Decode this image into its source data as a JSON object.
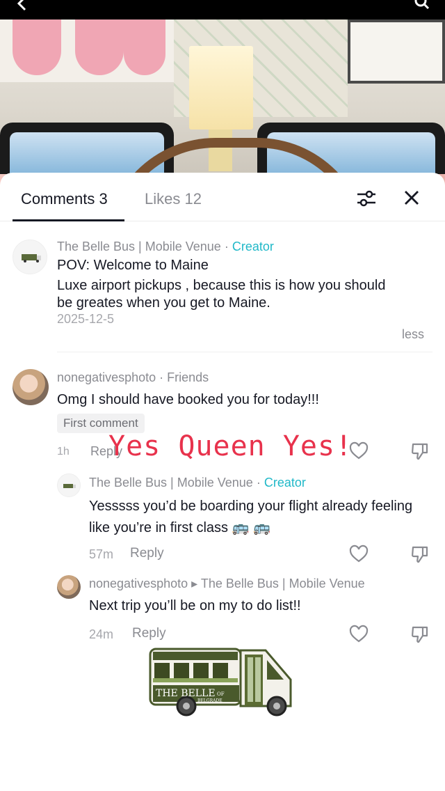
{
  "sheet": {
    "tabs": {
      "comments_label": "Comments 3",
      "likes_label": "Likes 12"
    }
  },
  "caption_comment": {
    "author": "The Belle Bus | Mobile Venue",
    "separator": " · ",
    "badge": "Creator",
    "title": "POV:  Welcome to Maine",
    "body": "Luxe airport pickups , because this is how you should be greates when you get to Maine.",
    "date": "2025-12-5",
    "less_label": "less"
  },
  "comments": [
    {
      "author": "nonegativesphoto",
      "separator": " · ",
      "relation": "Friends",
      "text": "Omg I should have booked you for today!!!",
      "chip": "First comment",
      "time": "1h",
      "reply_label": "Reply"
    }
  ],
  "replies": [
    {
      "author": "The Belle Bus | Mobile Venue",
      "separator": " · ",
      "badge": "Creator",
      "text": "Yesssss you’d be boarding your flight already feeling like you’re in first class 🚌 🚌",
      "time": "57m",
      "reply_label": "Reply"
    },
    {
      "author": "nonegativesphoto",
      "arrow": " ▸ ",
      "reply_to": "The Belle Bus | Mobile Venue",
      "text": "Next trip you’ll be on my to do list!!",
      "time": "24m",
      "reply_label": "Reply"
    }
  ],
  "overlay": {
    "text": "Yes Queen Yes!"
  },
  "sticker": {
    "line1": "THE BELLE",
    "of": "OF",
    "line2": "BELGRADE"
  },
  "colors": {
    "creator_badge": "#20b8c8",
    "overlay_text": "#e8324c",
    "bus_green": "#4a5a2c"
  }
}
